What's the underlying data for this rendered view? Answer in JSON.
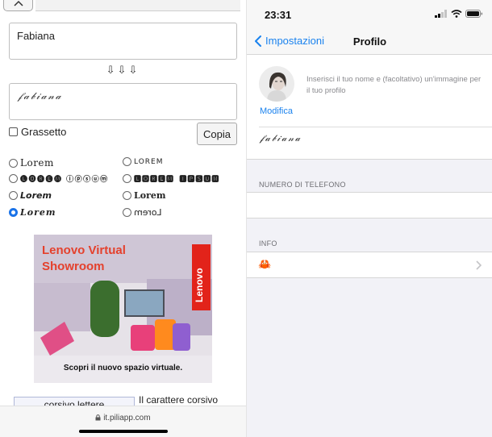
{
  "left": {
    "text_input_value": "Fabiana",
    "arrows": "⇩⇩⇩",
    "output_value": "𝒻𝒶𝒷𝒾𝒶𝓃𝒶",
    "bold_label": "Grassetto",
    "copy_label": "Copia",
    "styles": [
      {
        "label": "Lorem",
        "selected": false
      },
      {
        "label": "LOREM",
        "selected": false
      },
      {
        "label": "🅛🅞🅡🅔🅜 ⓘⓟⓢⓤⓜ",
        "selected": false
      },
      {
        "label": "🅻🅾🆁🅴🅼 🅸🅿🆂🆄🅼",
        "selected": false
      },
      {
        "label": "Lorem",
        "selected": false
      },
      {
        "label": "Lorem",
        "selected": false
      },
      {
        "label": "Lorem",
        "selected": true
      },
      {
        "label": "Lorem",
        "selected": false
      }
    ],
    "ad": {
      "title_line1": "Lenovo Virtual",
      "title_line2": "Showroom",
      "brand": "Lenovo",
      "caption": "Scopri il nuovo spazio virtuale.",
      "colors": {
        "accent": "#e4412d",
        "brand": "#e2231a"
      }
    },
    "bottom_box_text": "corsivo lettere",
    "bottom_text": "Il carattere corsivo",
    "url": "it.piliapp.com"
  },
  "right": {
    "time": "23:31",
    "back_label": "Impostazioni",
    "nav_title": "Profilo",
    "profile_hint": "Inserisci il tuo nome e (facoltativo) un'immagine per il tuo profilo",
    "edit_label": "Modifica",
    "profile_name": "𝒻𝒶𝒷𝒾𝒶𝓃𝒶",
    "phone_section": "NUMERO DI TELEFONO",
    "info_section": "INFO",
    "info_value": "🦀",
    "colors": {
      "link": "#1a82ee",
      "background": "#f2f2f7"
    }
  }
}
